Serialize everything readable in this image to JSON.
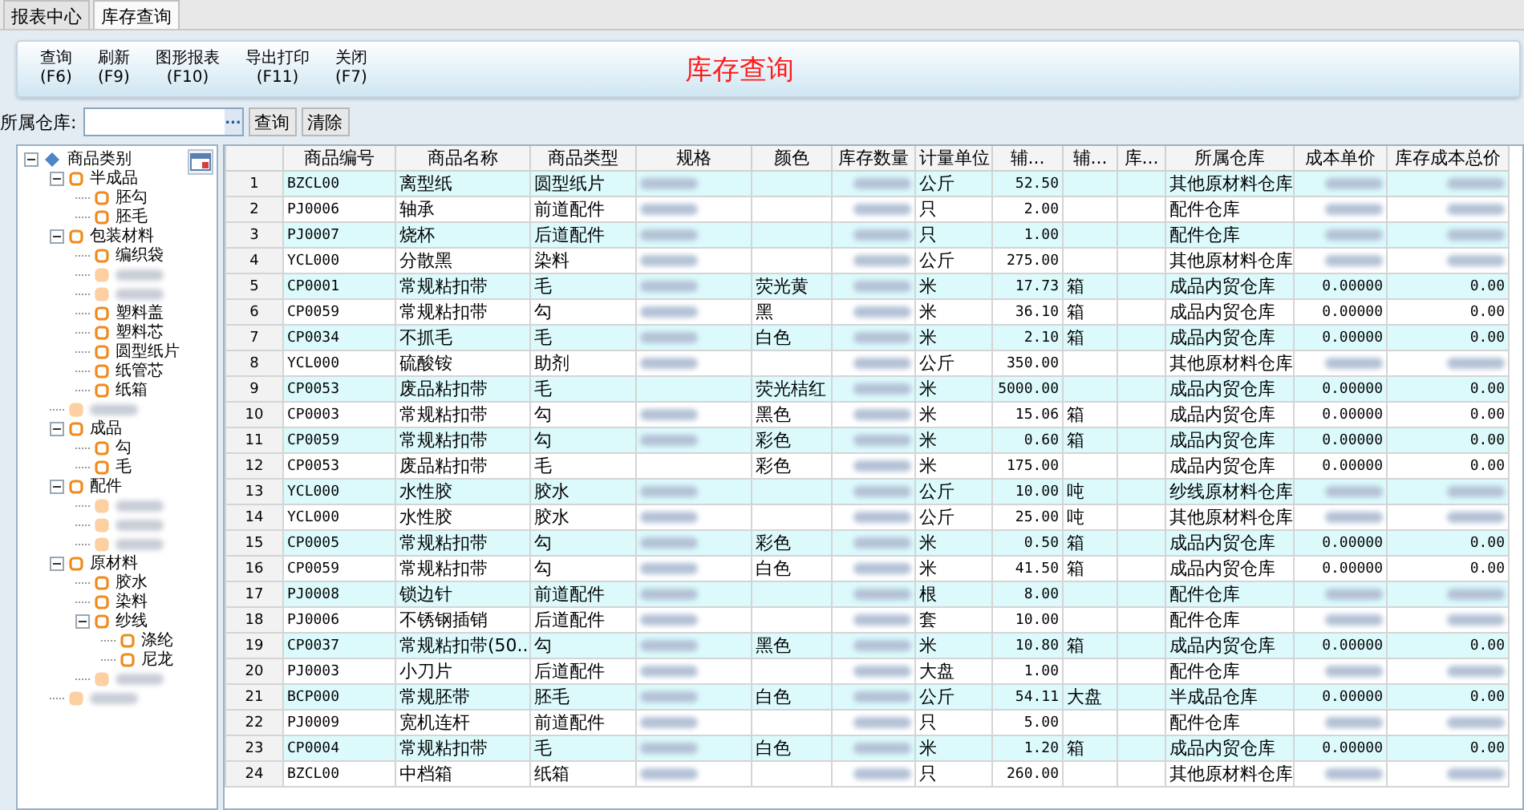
{
  "tabs": [
    {
      "label": "报表中心",
      "selected": false
    },
    {
      "label": "库存查询",
      "selected": true
    }
  ],
  "toolbar": {
    "buttons": [
      {
        "label": "查询",
        "key": "(F6)"
      },
      {
        "label": "刷新",
        "key": "(F9)"
      },
      {
        "label": "图形报表",
        "key": "(F10)"
      },
      {
        "label": "导出打印",
        "key": "(F11)"
      },
      {
        "label": "关闭",
        "key": "(F7)"
      }
    ],
    "title": "库存查询"
  },
  "filter": {
    "label": "所属仓库:",
    "browse_label": "...",
    "buttons": [
      "查询",
      "清除"
    ]
  },
  "tree": {
    "label": "商品类别",
    "expanded": true,
    "children": [
      {
        "label": "半成品",
        "expanded": true,
        "children": [
          {
            "label": "胚勾"
          },
          {
            "label": "胚毛"
          }
        ]
      },
      {
        "label": "包装材料",
        "expanded": true,
        "children": [
          {
            "label": "编织袋"
          },
          {
            "blurred": true
          },
          {
            "blurred": true
          },
          {
            "label": "塑料盖"
          },
          {
            "label": "塑料芯"
          },
          {
            "label": "圆型纸片"
          },
          {
            "label": "纸管芯"
          },
          {
            "label": "纸箱"
          }
        ]
      },
      {
        "blurred": true
      },
      {
        "label": "成品",
        "expanded": true,
        "children": [
          {
            "label": "勾"
          },
          {
            "label": "毛"
          }
        ]
      },
      {
        "label": "配件",
        "expanded": true,
        "children": [
          {
            "blurred": true
          },
          {
            "blurred": true
          },
          {
            "blurred": true
          }
        ]
      },
      {
        "label": "原材料",
        "expanded": true,
        "children": [
          {
            "label": "胶水"
          },
          {
            "label": "染料"
          },
          {
            "label": "纱线",
            "expanded": true,
            "children": [
              {
                "label": "涤纶"
              },
              {
                "label": "尼龙"
              }
            ]
          },
          {
            "blurred": true
          }
        ]
      },
      {
        "blurred": true
      }
    ]
  },
  "table": {
    "columns": [
      {
        "kind": "index"
      },
      {
        "label": "商品编号",
        "kind": "code"
      },
      {
        "label": "商品名称",
        "kind": "text"
      },
      {
        "label": "商品类型",
        "kind": "text"
      },
      {
        "label": "规格",
        "kind": "text"
      },
      {
        "label": "颜色",
        "kind": "text"
      },
      {
        "label": "库存数量",
        "kind": "number"
      },
      {
        "label": "计量单位",
        "kind": "text"
      },
      {
        "label": "辅...",
        "kind": "number"
      },
      {
        "label": "辅...",
        "kind": "text"
      },
      {
        "label": "库...",
        "kind": "text"
      },
      {
        "label": "所属仓库",
        "kind": "text"
      },
      {
        "label": "成本单价",
        "kind": "number"
      },
      {
        "label": "库存成本总价",
        "kind": "number"
      }
    ],
    "rows": [
      [
        "1",
        "BZCL00",
        "离型纸",
        "圆型纸片",
        {
          "blurred": true
        },
        null,
        {
          "blurred": true
        },
        "公斤",
        "52.50",
        null,
        null,
        "其他原材料仓库",
        {
          "blurred": true
        },
        {
          "blurred": true
        }
      ],
      [
        "2",
        "PJ0006",
        "轴承",
        "前道配件",
        {
          "blurred": true
        },
        null,
        {
          "blurred": true
        },
        "只",
        "2.00",
        null,
        null,
        "配件仓库",
        {
          "blurred": true
        },
        {
          "blurred": true
        }
      ],
      [
        "3",
        "PJ0007",
        "烧杯",
        "后道配件",
        {
          "blurred": true
        },
        null,
        {
          "blurred": true
        },
        "只",
        "1.00",
        null,
        null,
        "配件仓库",
        {
          "blurred": true
        },
        {
          "blurred": true
        }
      ],
      [
        "4",
        "YCL000",
        "分散黑",
        "染料",
        {
          "blurred": true
        },
        null,
        {
          "blurred": true
        },
        "公斤",
        "275.00",
        null,
        null,
        "其他原材料仓库",
        {
          "blurred": true
        },
        {
          "blurred": true
        }
      ],
      [
        "5",
        "CP0001",
        "常规粘扣带",
        "毛",
        {
          "blurred": true
        },
        "荧光黄",
        {
          "blurred": true
        },
        "米",
        "17.73",
        "箱",
        null,
        "成品内贸仓库",
        "0.00000",
        "0.00"
      ],
      [
        "6",
        "CP0059",
        "常规粘扣带",
        "勾",
        {
          "blurred": true
        },
        "黑",
        {
          "blurred": true
        },
        "米",
        "36.10",
        "箱",
        null,
        "成品内贸仓库",
        "0.00000",
        "0.00"
      ],
      [
        "7",
        "CP0034",
        "不抓毛",
        "毛",
        {
          "blurred": true
        },
        "白色",
        {
          "blurred": true
        },
        "米",
        "2.10",
        "箱",
        null,
        "成品内贸仓库",
        "0.00000",
        "0.00"
      ],
      [
        "8",
        "YCL000",
        "硫酸铵",
        "助剂",
        {
          "blurred": true
        },
        null,
        {
          "blurred": true
        },
        "公斤",
        "350.00",
        null,
        null,
        "其他原材料仓库",
        {
          "blurred": true
        },
        {
          "blurred": true
        }
      ],
      [
        "9",
        "CP0053",
        "废品粘扣带",
        "毛",
        null,
        "荧光桔红",
        {
          "blurred": true
        },
        "米",
        "5000.00",
        null,
        null,
        "成品内贸仓库",
        "0.00000",
        "0.00"
      ],
      [
        "10",
        "CP0003",
        "常规粘扣带",
        "勾",
        {
          "blurred": true
        },
        "黑色",
        {
          "blurred": true
        },
        "米",
        "15.06",
        "箱",
        null,
        "成品内贸仓库",
        "0.00000",
        "0.00"
      ],
      [
        "11",
        "CP0059",
        "常规粘扣带",
        "勾",
        {
          "blurred": true
        },
        "彩色",
        {
          "blurred": true
        },
        "米",
        "0.60",
        "箱",
        null,
        "成品内贸仓库",
        "0.00000",
        "0.00"
      ],
      [
        "12",
        "CP0053",
        "废品粘扣带",
        "毛",
        null,
        "彩色",
        {
          "blurred": true
        },
        "米",
        "175.00",
        null,
        null,
        "成品内贸仓库",
        "0.00000",
        "0.00"
      ],
      [
        "13",
        "YCL000",
        "水性胶",
        "胶水",
        {
          "blurred": true
        },
        null,
        {
          "blurred": true
        },
        "公斤",
        "10.00",
        "吨",
        null,
        "纱线原材料仓库",
        {
          "blurred": true
        },
        {
          "blurred": true
        }
      ],
      [
        "14",
        "YCL000",
        "水性胶",
        "胶水",
        {
          "blurred": true
        },
        null,
        {
          "blurred": true
        },
        "公斤",
        "25.00",
        "吨",
        null,
        "其他原材料仓库",
        {
          "blurred": true
        },
        {
          "blurred": true
        }
      ],
      [
        "15",
        "CP0005",
        "常规粘扣带",
        "勾",
        {
          "blurred": true
        },
        "彩色",
        {
          "blurred": true
        },
        "米",
        "0.50",
        "箱",
        null,
        "成品内贸仓库",
        "0.00000",
        "0.00"
      ],
      [
        "16",
        "CP0059",
        "常规粘扣带",
        "勾",
        {
          "blurred": true
        },
        "白色",
        {
          "blurred": true
        },
        "米",
        "41.50",
        "箱",
        null,
        "成品内贸仓库",
        "0.00000",
        "0.00"
      ],
      [
        "17",
        "PJ0008",
        "锁边针",
        "前道配件",
        {
          "blurred": true
        },
        null,
        {
          "blurred": true
        },
        "根",
        "8.00",
        null,
        null,
        "配件仓库",
        {
          "blurred": true
        },
        {
          "blurred": true
        }
      ],
      [
        "18",
        "PJ0006",
        "不锈钢插销",
        "后道配件",
        {
          "blurred": true
        },
        null,
        {
          "blurred": true
        },
        "套",
        "10.00",
        null,
        null,
        "配件仓库",
        {
          "blurred": true
        },
        {
          "blurred": true
        }
      ],
      [
        "19",
        "CP0037",
        "常规粘扣带(50...",
        "勾",
        {
          "blurred": true
        },
        "黑色",
        {
          "blurred": true
        },
        "米",
        "10.80",
        "箱",
        null,
        "成品内贸仓库",
        "0.00000",
        "0.00"
      ],
      [
        "20",
        "PJ0003",
        "小刀片",
        "后道配件",
        {
          "blurred": true
        },
        null,
        {
          "blurred": true
        },
        "大盘",
        "1.00",
        null,
        null,
        "配件仓库",
        {
          "blurred": true
        },
        {
          "blurred": true
        }
      ],
      [
        "21",
        "BCP000",
        "常规胚带",
        "胚毛",
        {
          "blurred": true
        },
        "白色",
        {
          "blurred": true
        },
        "公斤",
        "54.11",
        "大盘",
        null,
        "半成品仓库",
        "0.00000",
        "0.00"
      ],
      [
        "22",
        "PJ0009",
        "宽机连杆",
        "前道配件",
        {
          "blurred": true
        },
        null,
        {
          "blurred": true
        },
        "只",
        "5.00",
        null,
        null,
        "配件仓库",
        {
          "blurred": true
        },
        {
          "blurred": true
        }
      ],
      [
        "23",
        "CP0004",
        "常规粘扣带",
        "毛",
        {
          "blurred": true
        },
        "白色",
        {
          "blurred": true
        },
        "米",
        "1.20",
        "箱",
        null,
        "成品内贸仓库",
        "0.00000",
        "0.00"
      ],
      [
        "24",
        "BZCL00",
        "中档箱",
        "纸箱",
        {
          "blurred": true
        },
        null,
        {
          "blurred": true
        },
        "只",
        "260.00",
        null,
        null,
        "其他原材料仓库",
        {
          "blurred": true
        },
        {
          "blurred": true
        }
      ]
    ]
  }
}
